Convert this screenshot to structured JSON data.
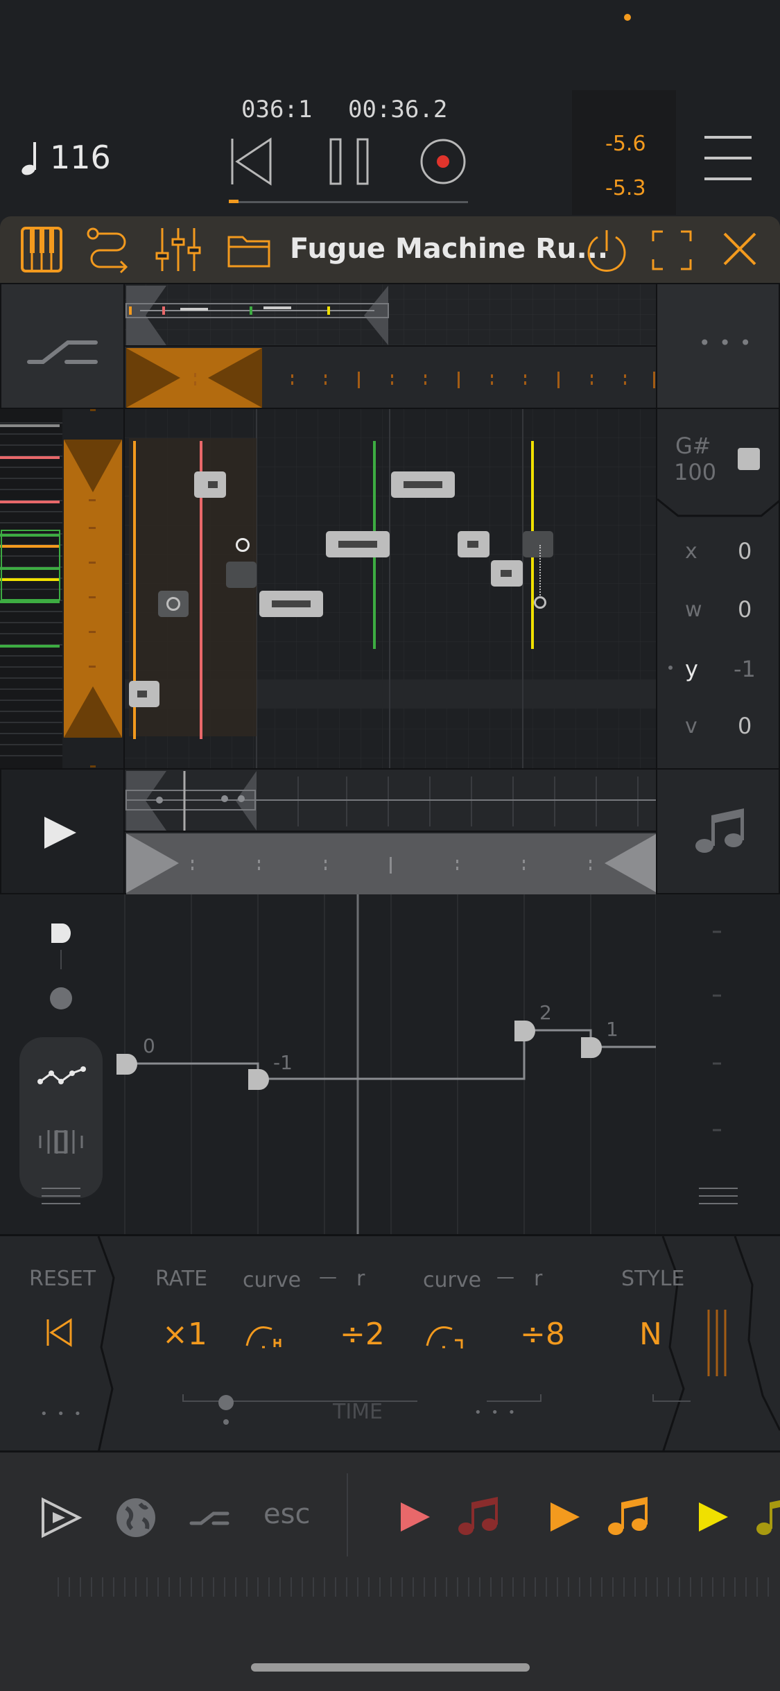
{
  "colors": {
    "accent": "#f39a1e",
    "bg": "#1e2023",
    "panel": "#25272a",
    "pink": "#e8686a",
    "dark_red": "#8a2c2c",
    "yellow": "#f0e000",
    "green": "#3dac42",
    "red_record": "#e0342c"
  },
  "transport": {
    "tempo": "116",
    "position_bars": "036:1",
    "position_time": "00:36.2",
    "level_top": "-5.6",
    "level_bottom": "-5.3",
    "icons": [
      "note-icon",
      "rewind-icon",
      "pause-icon",
      "record-icon",
      "menu-icon"
    ]
  },
  "plugin_bar": {
    "title": "Fugue Machine Ru...",
    "icons": [
      "piano-icon",
      "routing-icon",
      "mixer-icon",
      "folder-icon",
      "power-icon",
      "fullscreen-icon",
      "close-icon"
    ]
  },
  "editor": {
    "note_name": "G#",
    "velocity": "100",
    "params": [
      {
        "label": "x",
        "value": "0"
      },
      {
        "label": "w",
        "value": "0"
      },
      {
        "label": "y",
        "value": "-1"
      },
      {
        "label": "v",
        "value": "0"
      }
    ],
    "more_label": "• • •"
  },
  "pitch_graph": {
    "points": [
      {
        "label": "0"
      },
      {
        "label": "-1"
      },
      {
        "label": "2"
      },
      {
        "label": "1"
      }
    ]
  },
  "controls": {
    "reset_label": "RESET",
    "rate_label": "RATE",
    "curve1_label": "curve",
    "dash1": "—",
    "r1_label": "r",
    "curve2_label": "curve",
    "dash2": "—",
    "r2_label": "r",
    "style_label": "STYLE",
    "rate_value": "×1",
    "div1_value": "÷2",
    "div2_value": "÷8",
    "style_value": "N",
    "time_label": "TIME",
    "dots": "• • •"
  },
  "bottom_bar": {
    "esc_label": "esc"
  }
}
